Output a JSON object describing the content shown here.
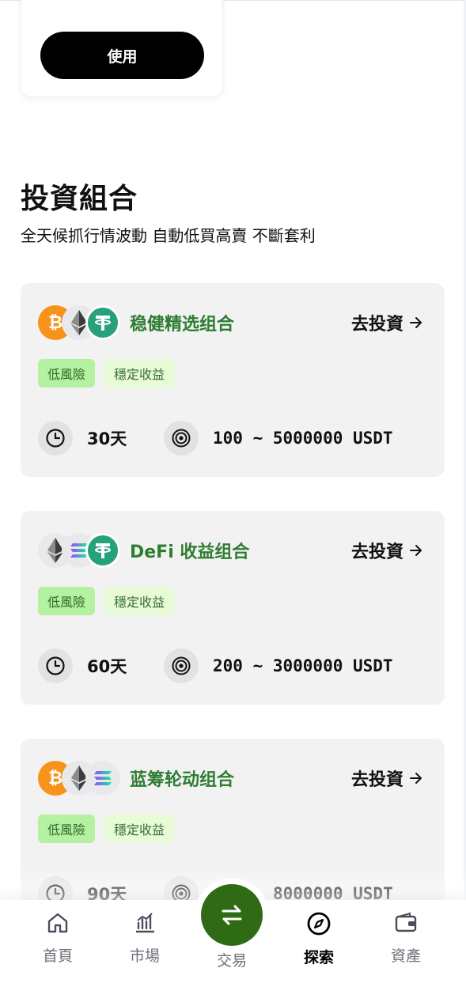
{
  "coupon": {
    "use_label": "使用"
  },
  "section": {
    "title": "投資組合",
    "subtitle": "全天候抓行情波動 自動低買高賣 不斷套利"
  },
  "portfolios": [
    {
      "name": "稳健精选组合",
      "coins": [
        "btc",
        "eth",
        "usdt"
      ],
      "invest_label": "去投資",
      "tags": [
        "低風險",
        "穩定收益"
      ],
      "days": "30天",
      "range": "100 ~ 5000000 USDT"
    },
    {
      "name": "DeFi 收益组合",
      "coins": [
        "eth",
        "sol",
        "usdt"
      ],
      "invest_label": "去投資",
      "tags": [
        "低風險",
        "穩定收益"
      ],
      "days": "60天",
      "range": "200 ~ 3000000 USDT"
    },
    {
      "name": "蓝筹轮动组合",
      "coins": [
        "btc",
        "eth",
        "sol"
      ],
      "invest_label": "去投資",
      "tags": [
        "低風險",
        "穩定收益"
      ],
      "days": "90天",
      "range": "8000000 USDT"
    }
  ],
  "nav": {
    "items": [
      {
        "label": "首頁",
        "icon": "home-icon",
        "active": false
      },
      {
        "label": "市場",
        "icon": "chart-icon",
        "active": false
      },
      {
        "label": "交易",
        "icon": "swap-icon",
        "active": false
      },
      {
        "label": "探索",
        "icon": "compass-icon",
        "active": true
      },
      {
        "label": "資產",
        "icon": "wallet-icon",
        "active": false
      }
    ]
  },
  "colors": {
    "accent_green": "#2e6b14",
    "portfolio_name": "#2e7d32",
    "tag_risk_bg": "#b4f1a0",
    "tag_yield_bg": "#e6fbd6",
    "card_bg": "#f2f2f2"
  }
}
